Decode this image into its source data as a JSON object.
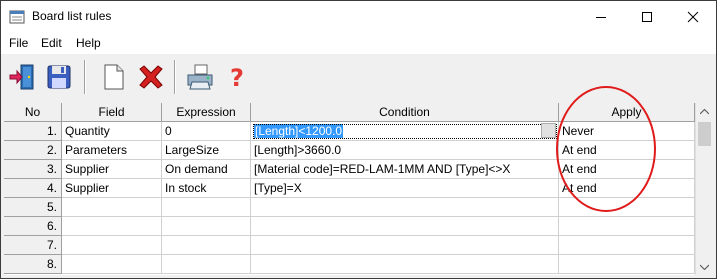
{
  "window": {
    "title": "Board list rules",
    "controls": {
      "minimize": "—",
      "maximize": "☐",
      "close": "✕"
    }
  },
  "menu": [
    "File",
    "Edit",
    "Help"
  ],
  "toolbar": {
    "buttons": [
      {
        "name": "exit-icon"
      },
      {
        "name": "save-icon"
      },
      {
        "name": "new-icon"
      },
      {
        "name": "delete-icon"
      },
      {
        "name": "print-icon"
      },
      {
        "name": "help-icon"
      }
    ]
  },
  "grid": {
    "headers": [
      "No",
      "Field",
      "Expression",
      "Condition",
      "Apply"
    ],
    "rows": [
      {
        "no": "1.",
        "field": "Quantity",
        "expression": "0",
        "condition": "[Length]<1200.0",
        "apply": "Never",
        "selected": true
      },
      {
        "no": "2.",
        "field": "Parameters",
        "expression": "LargeSize",
        "condition": "[Length]>3660.0",
        "apply": "At end"
      },
      {
        "no": "3.",
        "field": "Supplier",
        "expression": "On demand",
        "condition": "[Material code]=RED-LAM-1MM AND [Type]<>X",
        "apply": "At end"
      },
      {
        "no": "4.",
        "field": "Supplier",
        "expression": "In stock",
        "condition": "[Type]=X",
        "apply": "At end"
      },
      {
        "no": "5.",
        "field": "",
        "expression": "",
        "condition": "",
        "apply": ""
      },
      {
        "no": "6.",
        "field": "",
        "expression": "",
        "condition": "",
        "apply": ""
      },
      {
        "no": "7.",
        "field": "",
        "expression": "",
        "condition": "",
        "apply": ""
      },
      {
        "no": "8.",
        "field": "",
        "expression": "",
        "condition": "",
        "apply": ""
      }
    ]
  },
  "colors": {
    "selection": "#3399ff",
    "annotation_circle": "#e01b1b"
  }
}
